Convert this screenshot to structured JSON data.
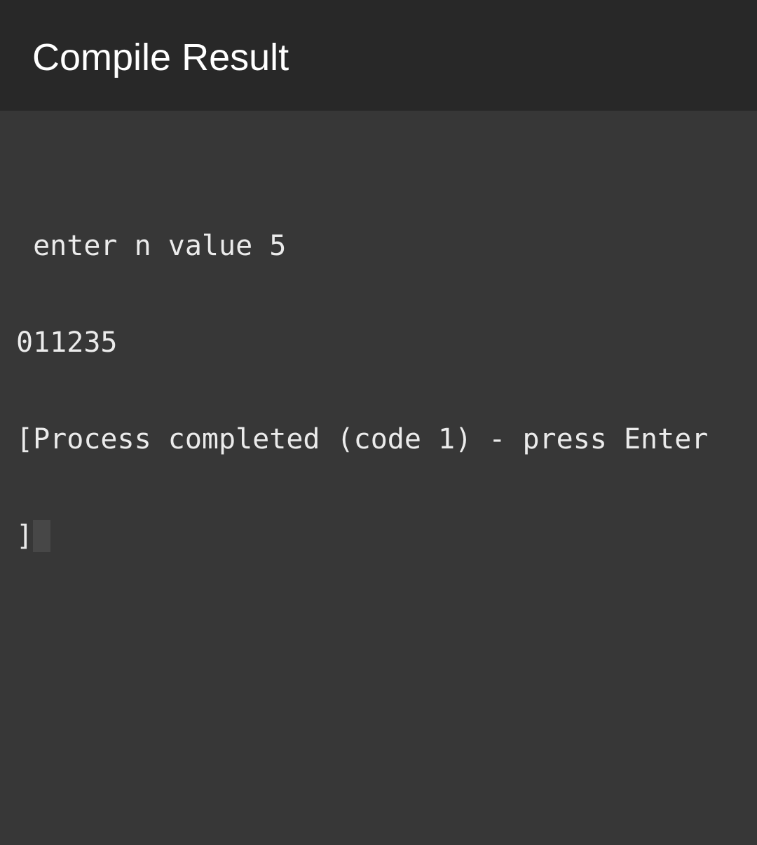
{
  "toolbar": {
    "title": "Compile Result"
  },
  "terminal": {
    "lines": [
      " enter n value 5",
      "011235",
      "[Process completed (code 1) - press Enter",
      "]"
    ]
  },
  "colors": {
    "toolbar_background": "#282828",
    "terminal_background": "#373737",
    "text": "#ebebeb",
    "cursor": "#474747"
  }
}
